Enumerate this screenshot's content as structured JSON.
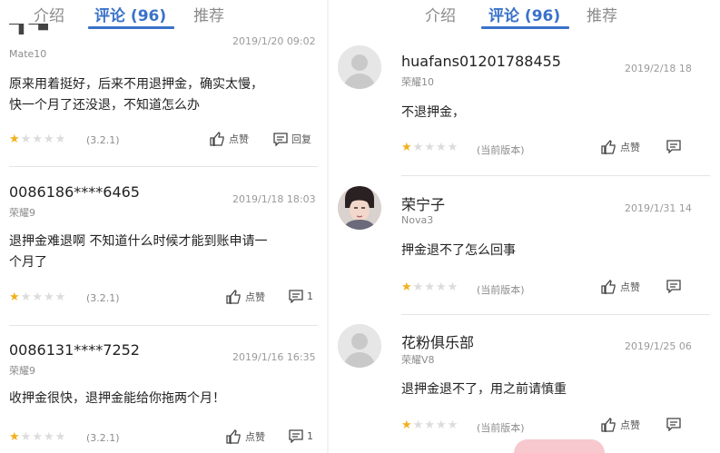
{
  "left": {
    "tabs": [
      {
        "label": "介绍",
        "active": false
      },
      {
        "label": "评论 (96)",
        "active": true
      },
      {
        "label": "推荐",
        "active": false
      }
    ],
    "reviews": [
      {
        "username": "",
        "device": "Mate10",
        "date": "2019/1/20 09:02",
        "content": [
          "原来用着挺好，后来不用退押金，确实太慢，",
          "快一个月了还没退，不知道怎么办"
        ],
        "rating": 1,
        "version": "(3.2.1)",
        "like_label": "点赞",
        "reply_label": "回复"
      },
      {
        "username": "0086186****6465",
        "device": "荣耀9",
        "date": "2019/1/18 18:03",
        "content": [
          "退押金难退啊 不知道什么时候才能到账申请一",
          "个月了"
        ],
        "rating": 1,
        "version": "(3.2.1)",
        "like_label": "点赞",
        "reply_label": "1"
      },
      {
        "username": "0086131****7252",
        "device": "荣耀9",
        "date": "2019/1/16 16:35",
        "content": [
          "收押金很快，退押金能给你拖两个月！"
        ],
        "rating": 1,
        "version": "(3.2.1)",
        "like_label": "点赞",
        "reply_label": "1"
      }
    ]
  },
  "right": {
    "tabs": [
      {
        "label": "介绍",
        "active": false
      },
      {
        "label": "评论 (96)",
        "active": true
      },
      {
        "label": "推荐",
        "active": false
      }
    ],
    "reviews": [
      {
        "username": "huafans01201788455",
        "device": "荣耀10",
        "date": "2019/2/18 18",
        "content": [
          "不退押金，"
        ],
        "rating": 1,
        "version": "(当前版本)",
        "like_label": "点赞",
        "avatar": "default"
      },
      {
        "username": "荣宁子",
        "device": "Nova3",
        "date": "2019/1/31 14",
        "content": [
          "押金退不了怎么回事"
        ],
        "rating": 1,
        "version": "(当前版本)",
        "like_label": "点赞",
        "avatar": "photo"
      },
      {
        "username": "花粉俱乐部",
        "device": "荣耀V8",
        "date": "2019/1/25 06",
        "content": [
          "退押金退不了，用之前请慎重"
        ],
        "rating": 1,
        "version": "(当前版本)",
        "like_label": "点赞",
        "avatar": "default"
      }
    ]
  },
  "colors": {
    "accent": "#3a72c8",
    "star_on": "#f1b01c",
    "star_off": "#dcdcdc"
  },
  "icons": {
    "like": "thumbs-up-icon",
    "reply": "comment-icon",
    "avatar_default": "default-avatar-icon"
  }
}
